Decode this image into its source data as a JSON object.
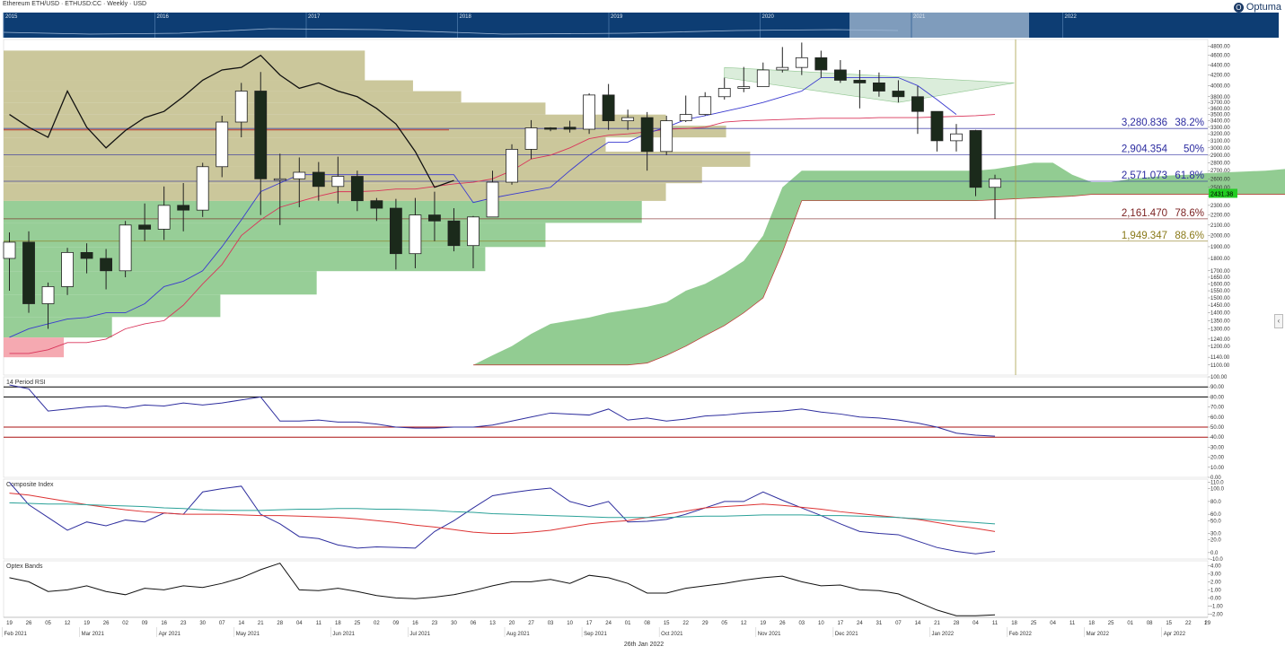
{
  "header": {
    "title": "Ethereum ETH/USD · ETHUSD:CC · Weekly · USD",
    "brand": "Optuma"
  },
  "navigator": {
    "years": [
      "2015",
      "2016",
      "2017",
      "2018",
      "2019",
      "2020",
      "2021",
      "2022"
    ]
  },
  "colors": {
    "navigator_bg": "#0d3d73",
    "navigator_window": "#7f9cbc",
    "up": "#ffffff",
    "down": "#1b2a1b",
    "cloud": "#8cc98c",
    "volume_up": "#8cc98c",
    "volume_down": "#c5c190",
    "volume_poc": "#c0392b",
    "rsi": "#2e2e9e",
    "composite": "#2e2e9e",
    "composite_fast": "#d33",
    "composite_slow": "#2aa198",
    "optex": "#111111",
    "price_label": "#22cc22"
  },
  "chart_data": [
    {
      "type": "candlestick",
      "title": "",
      "x": [
        "19",
        "26",
        "05",
        "12",
        "19",
        "26",
        "02",
        "09",
        "16",
        "23",
        "30",
        "07",
        "14",
        "21",
        "28",
        "04",
        "11",
        "18",
        "25",
        "02",
        "09",
        "16",
        "23",
        "30",
        "06",
        "13",
        "20",
        "27",
        "03",
        "10",
        "17",
        "24",
        "01",
        "08",
        "15",
        "22",
        "29",
        "05",
        "12",
        "19",
        "26",
        "03",
        "10",
        "17",
        "24",
        "31",
        "07",
        "14",
        "21",
        "28"
      ],
      "month_labels": [
        "Feb 2021",
        "Mar 2021",
        "Apr 2021",
        "May 2021",
        "Jun 2021",
        "Jul 2021",
        "Aug 2021",
        "Sep 2021",
        "Oct 2021",
        "Nov 2021",
        "Dec 2021",
        "Jan 2022",
        "Feb 2022",
        "Mar 2022",
        "Apr 2022"
      ],
      "future_x": [
        "04",
        "11",
        "18",
        "25",
        "04",
        "11",
        "18",
        "25",
        "01",
        "08",
        "15",
        "22",
        "29"
      ],
      "date_label": "26th Jan 2022",
      "scale": "log",
      "ylim": [
        1050,
        4950
      ],
      "y_ticks": [
        4800,
        4600,
        4400,
        4200,
        4000,
        3800,
        3700,
        3600,
        3500,
        3400,
        3300,
        3200,
        3100,
        3000,
        2900,
        2800,
        2700,
        2600,
        2500,
        2400,
        2300,
        2200,
        2100,
        2000,
        1900,
        1800,
        1700,
        1650,
        1600,
        1550,
        1500,
        1450,
        1400,
        1350,
        1300,
        1240,
        1200,
        1140,
        1100
      ],
      "y_tick_format": "0.00",
      "current_price_label": "2431.38",
      "ohlc": [
        [
          1800,
          2030,
          1550,
          1940
        ],
        [
          1940,
          2040,
          1400,
          1460
        ],
        [
          1460,
          1610,
          1300,
          1580
        ],
        [
          1580,
          1890,
          1520,
          1850
        ],
        [
          1850,
          1930,
          1680,
          1800
        ],
        [
          1800,
          1880,
          1560,
          1700
        ],
        [
          1700,
          2140,
          1650,
          2100
        ],
        [
          2100,
          2320,
          1950,
          2060
        ],
        [
          2060,
          2510,
          1960,
          2300
        ],
        [
          2300,
          2550,
          2040,
          2250
        ],
        [
          2250,
          2800,
          2180,
          2750
        ],
        [
          2750,
          3480,
          2620,
          3380
        ],
        [
          3380,
          4050,
          3150,
          3900
        ],
        [
          3900,
          4260,
          2200,
          2600
        ],
        [
          2600,
          2920,
          2100,
          2600
        ],
        [
          2600,
          2870,
          2280,
          2680
        ],
        [
          2680,
          2810,
          2350,
          2510
        ],
        [
          2510,
          2880,
          2320,
          2630
        ],
        [
          2630,
          2700,
          2240,
          2350
        ],
        [
          2350,
          2380,
          2140,
          2270
        ],
        [
          2270,
          2370,
          1710,
          1840
        ],
        [
          1840,
          2380,
          1720,
          2200
        ],
        [
          2200,
          2450,
          1950,
          2140
        ],
        [
          2140,
          2270,
          1860,
          1910
        ],
        [
          1910,
          2190,
          1720,
          2180
        ],
        [
          2180,
          2700,
          2180,
          2560
        ],
        [
          2560,
          3050,
          2530,
          2980
        ],
        [
          2980,
          3410,
          2850,
          3290
        ],
        [
          3290,
          3300,
          3240,
          3280
        ],
        [
          3300,
          3400,
          3220,
          3270
        ],
        [
          3270,
          3860,
          3200,
          3830
        ],
        [
          3830,
          4030,
          3260,
          3400
        ],
        [
          3400,
          3580,
          3260,
          3450
        ],
        [
          3450,
          3540,
          2700,
          2950
        ],
        [
          2950,
          3480,
          2900,
          3400
        ],
        [
          3400,
          3820,
          3380,
          3500
        ],
        [
          3500,
          3880,
          3480,
          3800
        ],
        [
          3800,
          4150,
          3750,
          3950
        ],
        [
          3950,
          4360,
          3880,
          3980
        ],
        [
          3980,
          4450,
          3980,
          4300
        ],
        [
          4300,
          4780,
          4250,
          4350
        ],
        [
          4350,
          4880,
          4200,
          4550
        ],
        [
          4550,
          4700,
          4150,
          4300
        ],
        [
          4300,
          4500,
          4050,
          4100
        ],
        [
          4100,
          4300,
          3600,
          4050
        ],
        [
          4050,
          4250,
          3800,
          3900
        ],
        [
          3900,
          4100,
          3700,
          3800
        ],
        [
          3800,
          3990,
          3200,
          3550
        ],
        [
          3550,
          3550,
          2950,
          3100
        ],
        [
          3100,
          3350,
          2950,
          3200
        ],
        [
          3250,
          3260,
          2400,
          2500
        ],
        [
          2500,
          2650,
          2160,
          2600
        ]
      ],
      "overlays": {
        "ichimoku_conversion": [
          1250,
          1300,
          1330,
          1360,
          1370,
          1400,
          1400,
          1460,
          1580,
          1620,
          1700,
          1900,
          2150,
          2450,
          2550,
          2650,
          2650,
          2650,
          2650,
          2650,
          2650,
          2650,
          2650,
          2650,
          2330,
          2380,
          2420,
          2460,
          2500,
          2700,
          2900,
          3080,
          3080,
          3210,
          3300,
          3420,
          3480,
          3550,
          3620,
          3700,
          3800,
          3900,
          4150,
          4150,
          4150,
          4150,
          4150,
          4000,
          3750,
          3500
        ],
        "ichimoku_base": [
          1160,
          1160,
          1180,
          1220,
          1220,
          1240,
          1300,
          1330,
          1350,
          1450,
          1600,
          1750,
          2000,
          2150,
          2280,
          2340,
          2400,
          2450,
          2450,
          2460,
          2480,
          2480,
          2510,
          2540,
          2560,
          2600,
          2700,
          2850,
          2900,
          3000,
          3130,
          3180,
          3200,
          3230,
          3270,
          3280,
          3300,
          3380,
          3400,
          3410,
          3420,
          3430,
          3440,
          3440,
          3440,
          3450,
          3450,
          3450,
          3460,
          3470,
          3480,
          3500
        ],
        "lagging_span": [
          3500,
          3300,
          3150,
          3900,
          3300,
          3000,
          3250,
          3450,
          3550,
          3800,
          4100,
          4300,
          4350,
          4600,
          4200,
          3950,
          4050,
          3900,
          3800,
          3600,
          3350,
          2950,
          2500,
          2580
        ],
        "cloud_upper": [
          1100,
          1150,
          1200,
          1270,
          1330,
          1350,
          1370,
          1400,
          1420,
          1440,
          1470,
          1550,
          1600,
          1680,
          1780,
          2000,
          2500,
          2700,
          2700,
          2700,
          2700,
          2700,
          2700,
          2700,
          2700,
          2700,
          2700,
          2720,
          2760,
          2800,
          2800,
          2650,
          2560,
          2560,
          2600,
          2620,
          2640,
          2650,
          2670,
          2680,
          2690,
          2700,
          2720,
          2760,
          2800,
          2850,
          2900,
          2950,
          3000,
          3050
        ],
        "cloud_lower": [
          1100,
          1100,
          1100,
          1100,
          1100,
          1100,
          1100,
          1100,
          1100,
          1110,
          1150,
          1200,
          1260,
          1320,
          1400,
          1500,
          1850,
          2350,
          2350,
          2350,
          2350,
          2350,
          2350,
          2350,
          2350,
          2350,
          2350,
          2360,
          2370,
          2380,
          2390,
          2400,
          2420,
          2420,
          2420,
          2420,
          2420,
          2420,
          2420,
          2420,
          2420,
          2420,
          2420,
          2420,
          2420,
          2420,
          2420,
          2420,
          2420,
          2430
        ],
        "cloud_start_index": 30
      },
      "fib_levels": [
        {
          "value": 3280.836,
          "label": "3,280.836",
          "pct": "38.2%",
          "color": "#2b2ba0"
        },
        {
          "value": 2904.354,
          "label": "2,904.354",
          "pct": "50%",
          "color": "#2b2ba0"
        },
        {
          "value": 2571.073,
          "label": "2,571.073",
          "pct": "61.8%",
          "color": "#2b2ba0"
        },
        {
          "value": 2161.47,
          "label": "2,161.470",
          "pct": "78.6%",
          "color": "#7a1f1f"
        },
        {
          "value": 1949.347,
          "label": "1,949.347",
          "pct": "88.6%",
          "color": "#8a7a1a"
        }
      ],
      "poc_level": 3260,
      "channel": {
        "start": 19,
        "end": 31,
        "upper_start": 4350,
        "upper_end": 4050,
        "lower_start": 4150,
        "lower_end": 3700
      },
      "volume_profile": [
        {
          "price": 4200,
          "width": 0.3,
          "kind": "tan"
        },
        {
          "price": 4000,
          "width": 0.34,
          "kind": "tan"
        },
        {
          "price": 3800,
          "width": 0.38,
          "kind": "tan"
        },
        {
          "price": 3600,
          "width": 0.45,
          "kind": "tan"
        },
        {
          "price": 3400,
          "width": 0.55,
          "kind": "tan"
        },
        {
          "price": 3250,
          "width": 0.6,
          "kind": "tan"
        },
        {
          "price": 3050,
          "width": 0.5,
          "kind": "tan"
        },
        {
          "price": 2850,
          "width": 0.62,
          "kind": "tan"
        },
        {
          "price": 2650,
          "width": 0.58,
          "kind": "tan"
        },
        {
          "price": 2450,
          "width": 0.55,
          "kind": "tan"
        },
        {
          "price": 2250,
          "width": 0.53,
          "kind": "green"
        },
        {
          "price": 2000,
          "width": 0.45,
          "kind": "green"
        },
        {
          "price": 1800,
          "width": 0.4,
          "kind": "green"
        },
        {
          "price": 1600,
          "width": 0.26,
          "kind": "green"
        },
        {
          "price": 1450,
          "width": 0.18,
          "kind": "green"
        },
        {
          "price": 1300,
          "width": 0.09,
          "kind": "green"
        },
        {
          "price": 1200,
          "width": 0.05,
          "kind": "red"
        }
      ]
    },
    {
      "type": "line",
      "title": "14 Period RSI",
      "ylim": [
        0,
        100
      ],
      "y_ticks": [
        "100.00",
        "90.00",
        "80.00",
        "70.00",
        "60.00",
        "50.00",
        "40.00",
        "30.00",
        "20.00",
        "10.00",
        "0.00"
      ],
      "reference_lines": [
        {
          "value": 90,
          "color": "#000000"
        },
        {
          "value": 80,
          "color": "#000000"
        },
        {
          "value": 50,
          "color": "#aa1111"
        },
        {
          "value": 40,
          "color": "#aa1111"
        }
      ],
      "series": [
        {
          "values": [
            92,
            88,
            66,
            68,
            70,
            71,
            69,
            72,
            71,
            74,
            72,
            74,
            77,
            80,
            56,
            56,
            57,
            55,
            55,
            53,
            50,
            49,
            49,
            50,
            50,
            52,
            56,
            60,
            64,
            63,
            62,
            68,
            57,
            59,
            56,
            58,
            61,
            62,
            64,
            65,
            66,
            68,
            65,
            63,
            60,
            59,
            57,
            54,
            50,
            44,
            42,
            41
          ]
        }
      ]
    },
    {
      "type": "line",
      "title": "Composite Index",
      "ylim": [
        -10,
        115
      ],
      "y_ticks": [
        "110.0",
        "100.0",
        "80.0",
        "60.0",
        "50.0",
        "30.0",
        "20.0",
        "0.0",
        "-10.0"
      ],
      "series": [
        {
          "values": [
            110,
            75,
            55,
            35,
            48,
            42,
            51,
            48,
            62,
            60,
            95,
            100,
            104,
            60,
            45,
            25,
            22,
            12,
            7,
            9,
            8,
            7,
            33,
            50,
            70,
            89,
            94,
            98,
            101,
            80,
            72,
            80,
            48,
            49,
            52,
            60,
            70,
            80,
            80,
            95,
            82,
            70,
            58,
            45,
            33,
            30,
            28,
            18,
            8,
            2,
            -2,
            2
          ]
        },
        {
          "values": [
            93,
            90,
            85,
            80,
            75,
            71,
            67,
            64,
            62,
            60,
            60,
            60,
            59,
            58,
            58,
            57,
            56,
            55,
            53,
            50,
            47,
            43,
            40,
            36,
            32,
            30,
            30,
            32,
            35,
            40,
            45,
            48,
            50,
            55,
            60,
            65,
            70,
            72,
            74,
            76,
            74,
            71,
            68,
            64,
            61,
            58,
            55,
            52,
            47,
            42,
            38,
            33
          ]
        },
        {
          "values": [
            78,
            77,
            76,
            76,
            75,
            74,
            73,
            72,
            70,
            69,
            67,
            66,
            66,
            66,
            67,
            68,
            68,
            69,
            69,
            68,
            68,
            67,
            66,
            64,
            63,
            61,
            60,
            59,
            58,
            57,
            56,
            55,
            55,
            55,
            55,
            56,
            57,
            57,
            58,
            59,
            59,
            59,
            58,
            58,
            57,
            56,
            55,
            53,
            51,
            49,
            47,
            45
          ]
        }
      ]
    },
    {
      "type": "line",
      "title": "Optex Bands",
      "ylim": [
        -2.4,
        4.6
      ],
      "y_ticks": [
        "4.00",
        "3.00",
        "2.00",
        "1.00",
        "0.00",
        "-1.00",
        "-2.00"
      ],
      "series": [
        {
          "values": [
            2.5,
            2.0,
            0.8,
            1.0,
            1.5,
            0.8,
            0.4,
            1.2,
            1.0,
            1.5,
            1.3,
            1.8,
            2.5,
            3.5,
            4.3,
            1.0,
            0.9,
            1.2,
            0.8,
            0.3,
            0.0,
            -0.1,
            0.1,
            0.4,
            0.9,
            1.5,
            2.0,
            2.0,
            2.3,
            1.8,
            2.8,
            2.5,
            1.8,
            0.6,
            0.6,
            1.2,
            1.5,
            1.8,
            2.2,
            2.5,
            2.7,
            2.0,
            1.5,
            1.6,
            1.0,
            0.9,
            0.5,
            -0.5,
            -1.5,
            -2.2,
            -2.2,
            -2.1
          ]
        }
      ]
    }
  ]
}
